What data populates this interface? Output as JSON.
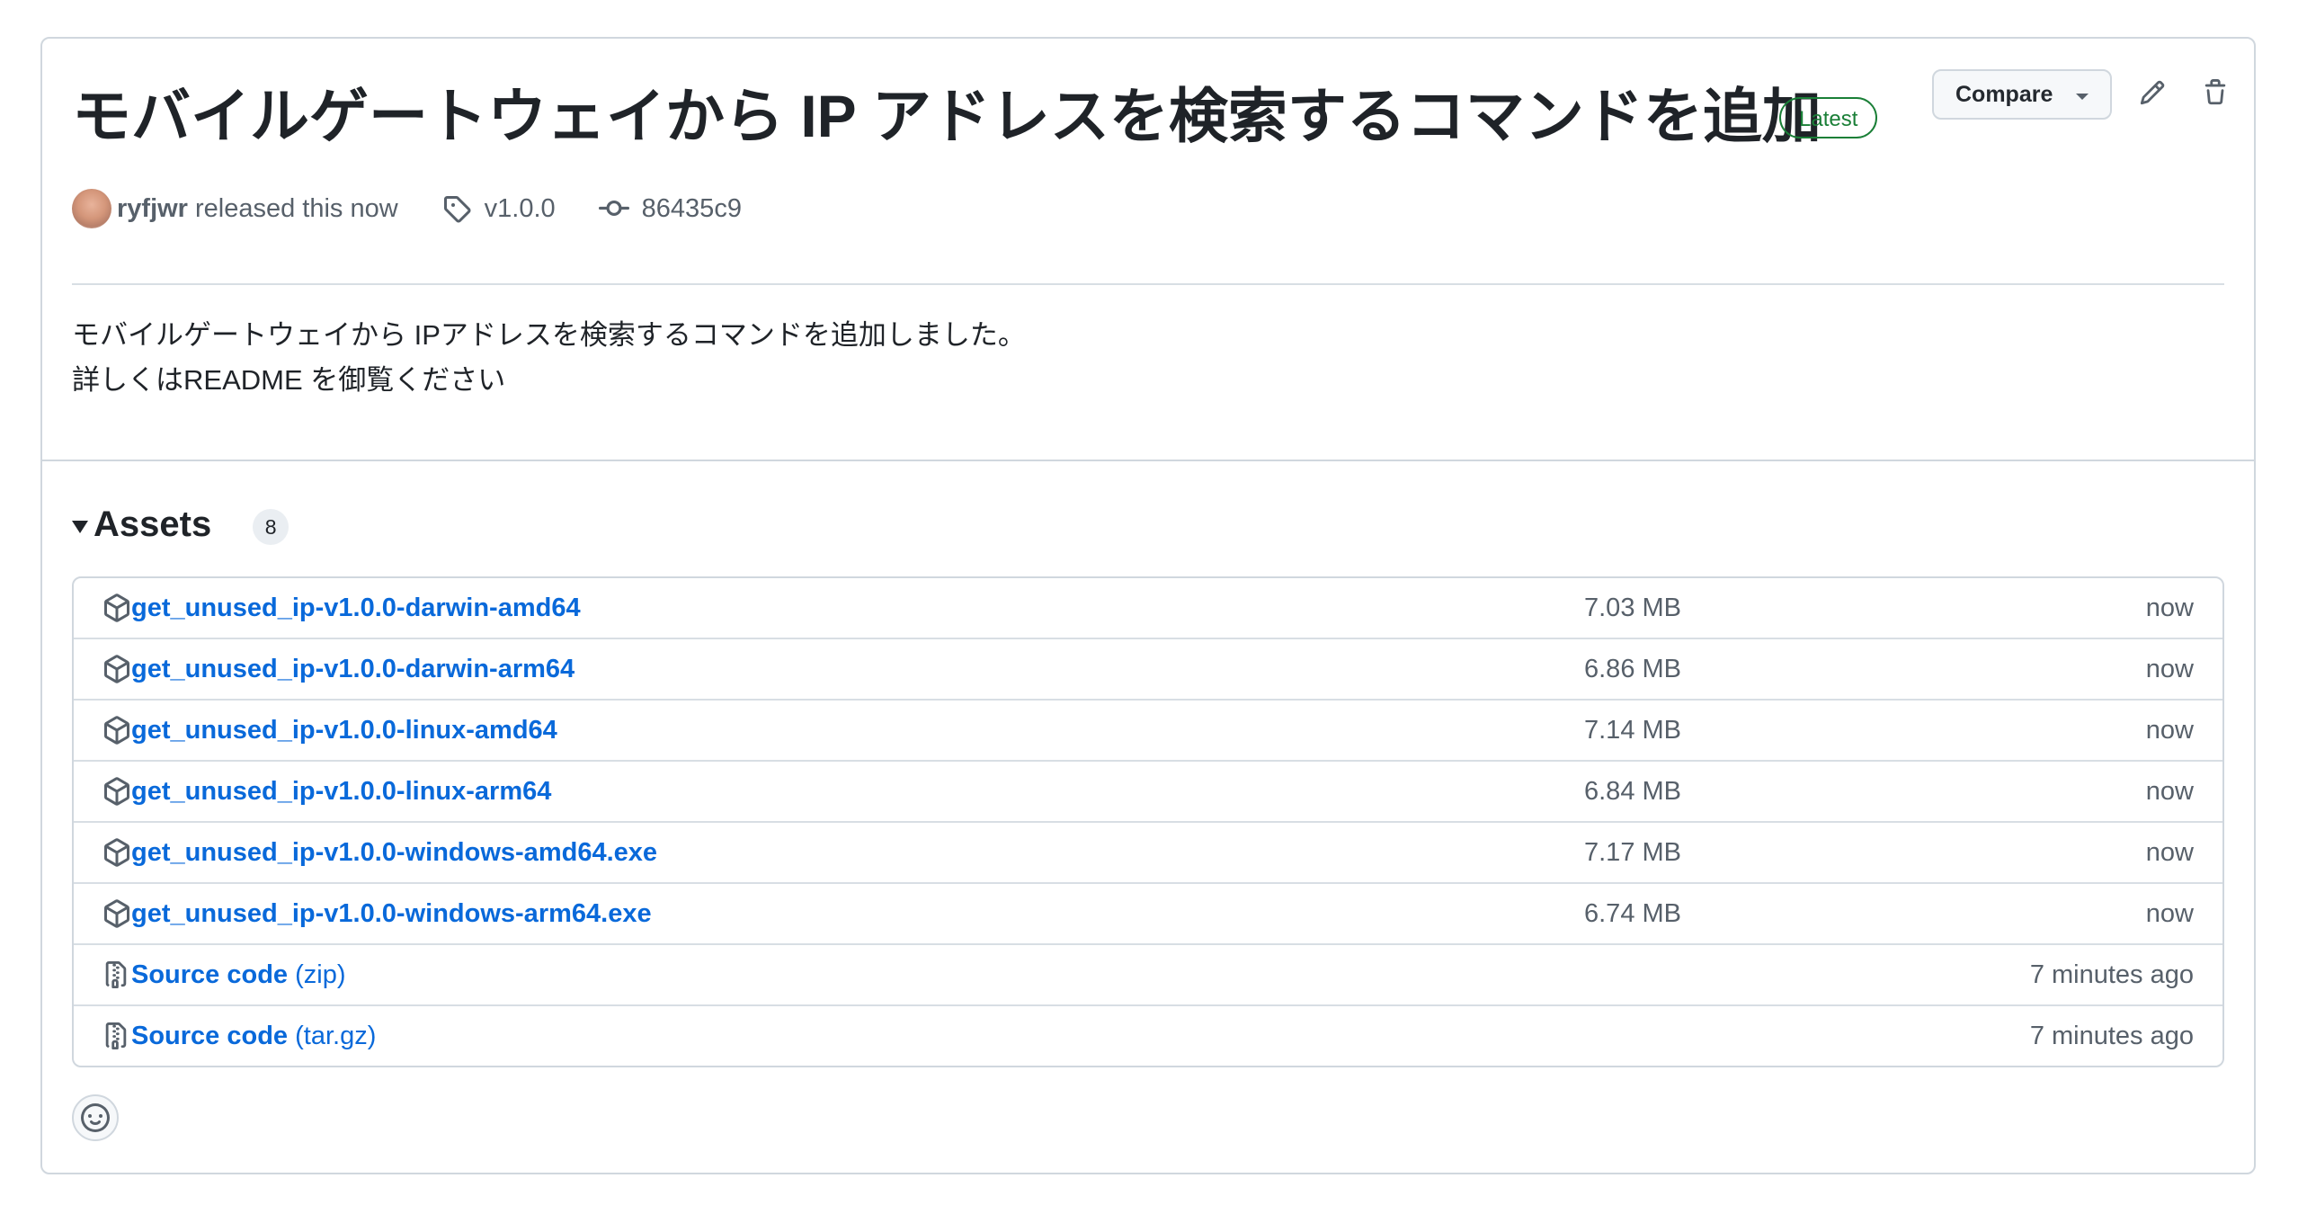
{
  "release": {
    "title": "モバイルゲートウェイから IP アドレスを検索するコマンドを追加",
    "latest_label": "Latest",
    "compare_label": "Compare",
    "author": "ryfjwr",
    "released_text": "released this now",
    "tag": "v1.0.0",
    "commit": "86435c9",
    "body_lines": [
      "モバイルゲートウェイから IPアドレスを検索するコマンドを追加しました。",
      "詳しくはREADME を御覧ください"
    ]
  },
  "assets": {
    "title": "Assets",
    "count": "8",
    "items": [
      {
        "name": "get_unused_ip-v1.0.0-darwin-amd64",
        "suffix": "",
        "size": "7.03 MB",
        "date": "now",
        "icon": "package-icon"
      },
      {
        "name": "get_unused_ip-v1.0.0-darwin-arm64",
        "suffix": "",
        "size": "6.86 MB",
        "date": "now",
        "icon": "package-icon"
      },
      {
        "name": "get_unused_ip-v1.0.0-linux-amd64",
        "suffix": "",
        "size": "7.14 MB",
        "date": "now",
        "icon": "package-icon"
      },
      {
        "name": "get_unused_ip-v1.0.0-linux-arm64",
        "suffix": "",
        "size": "6.84 MB",
        "date": "now",
        "icon": "package-icon"
      },
      {
        "name": "get_unused_ip-v1.0.0-windows-amd64.exe",
        "suffix": "",
        "size": "7.17 MB",
        "date": "now",
        "icon": "package-icon"
      },
      {
        "name": "get_unused_ip-v1.0.0-windows-arm64.exe",
        "suffix": "",
        "size": "6.74 MB",
        "date": "now",
        "icon": "package-icon"
      },
      {
        "name": "Source code",
        "suffix": "(zip)",
        "size": "",
        "date": "7 minutes ago",
        "icon": "file-zip-icon"
      },
      {
        "name": "Source code",
        "suffix": "(tar.gz)",
        "size": "",
        "date": "7 minutes ago",
        "icon": "file-zip-icon"
      }
    ]
  },
  "colors": {
    "link": "#0969da",
    "muted": "#57606a",
    "latest_green": "#1a7f37",
    "border": "#d0d7de"
  }
}
